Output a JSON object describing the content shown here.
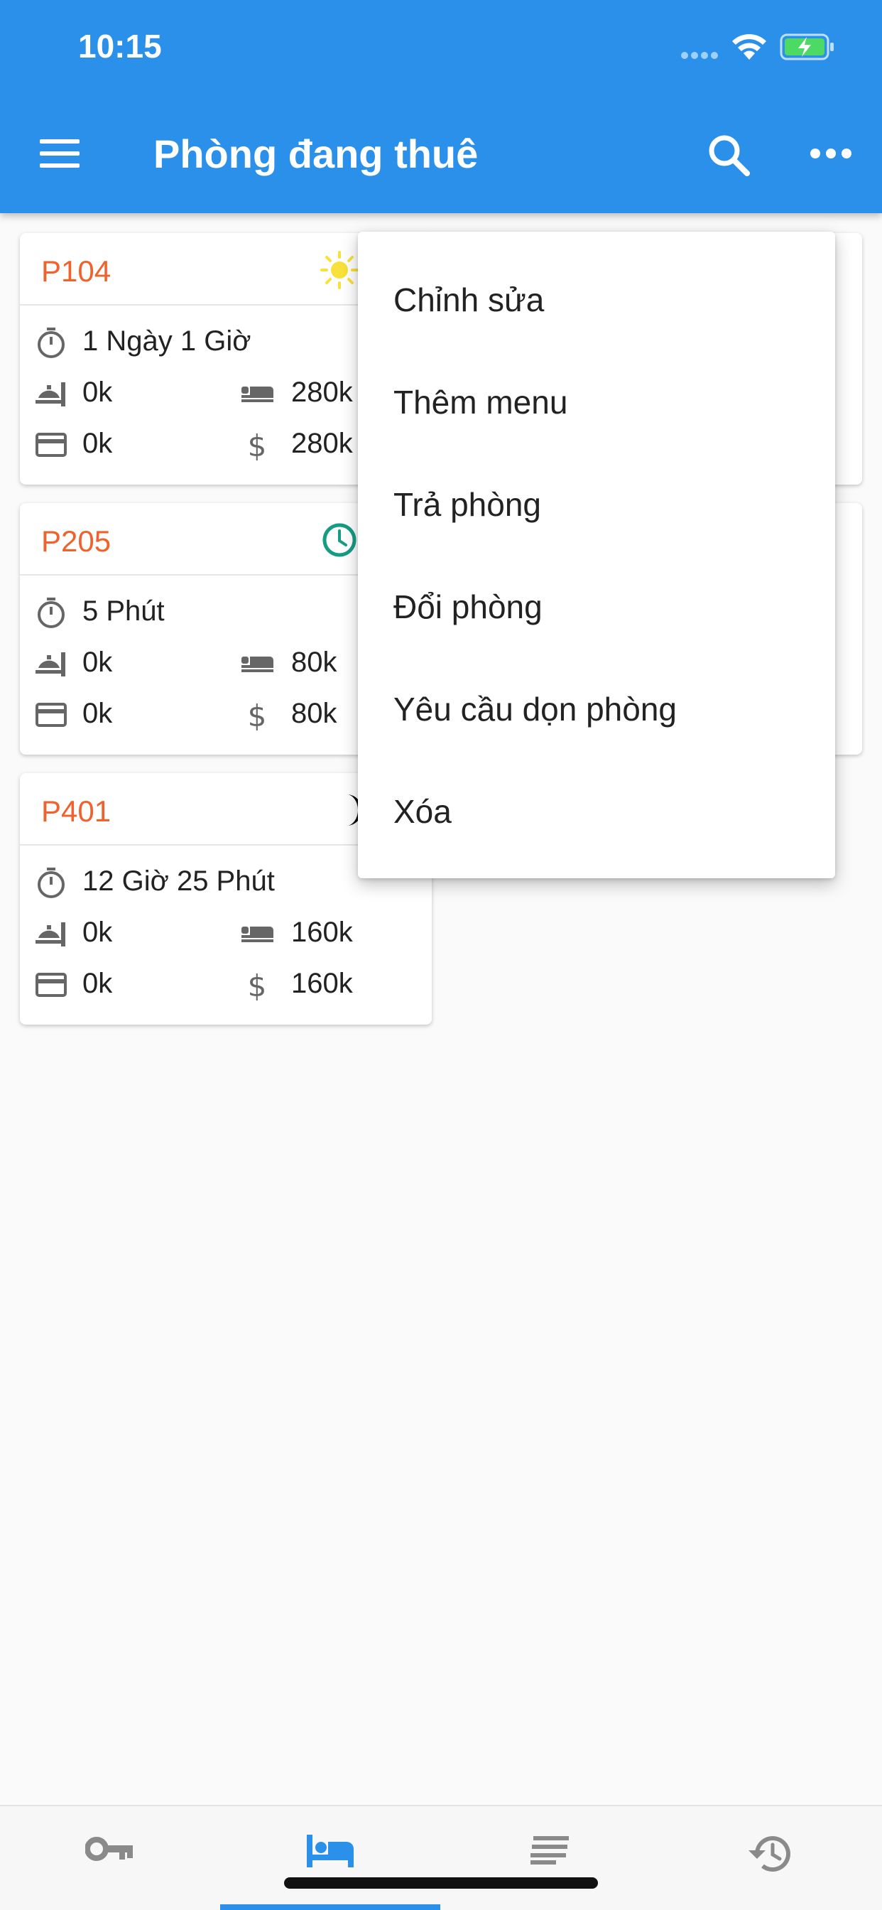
{
  "status": {
    "time": "10:15"
  },
  "appbar": {
    "title": "Phòng đang thuê"
  },
  "rooms": [
    {
      "code": "P104",
      "period_icon": "sun-icon",
      "duration": "1 Ngày 1 Giờ",
      "service": "0k",
      "room_fee": "280k",
      "paid": "0k",
      "total": "280k"
    },
    {
      "code": "P205",
      "period_icon": "clock-icon",
      "duration": "5 Phút",
      "service": "0k",
      "room_fee": "80k",
      "paid": "0k",
      "total": "80k"
    },
    {
      "code": "P401",
      "period_icon": "moon-icon",
      "duration": "12 Giờ 25 Phút",
      "service": "0k",
      "room_fee": "160k",
      "paid": "0k",
      "total": "160k"
    }
  ],
  "popup_menu": {
    "items": [
      "Chỉnh sửa",
      "Thêm menu",
      "Trả phòng",
      "Đổi phòng",
      "Yêu cầu dọn phòng",
      "Xóa"
    ]
  },
  "bottom_nav": {
    "items": [
      {
        "icon": "key-icon"
      },
      {
        "icon": "bed-icon",
        "active": true
      },
      {
        "icon": "list-icon"
      },
      {
        "icon": "history-icon"
      }
    ]
  },
  "colors": {
    "appbar": "#2b90ea",
    "room_code": "#f0612b",
    "accent": "#2b90ea"
  }
}
